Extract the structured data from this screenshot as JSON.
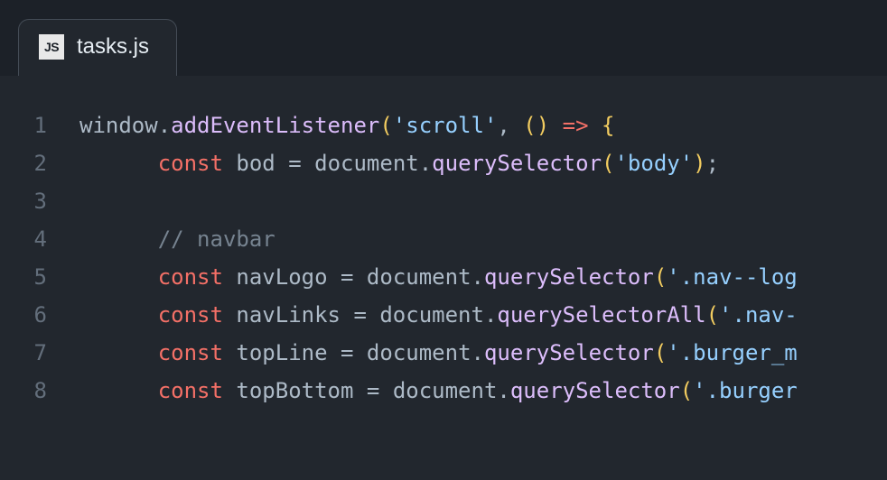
{
  "tab": {
    "icon_text": "JS",
    "filename": "tasks.js"
  },
  "gutter": {
    "1": "1",
    "2": "2",
    "3": "3",
    "4": "4",
    "5": "5",
    "6": "6",
    "7": "7",
    "8": "8"
  },
  "code": {
    "l1": {
      "obj": "window",
      "dot": ".",
      "method": "addEventListener",
      "open": "(",
      "arg1": "'scroll'",
      "comma": ", ",
      "arrow_open": "(",
      "arrow_close": ")",
      "arrow": " => ",
      "brace": "{"
    },
    "l2": {
      "indent": "      ",
      "kw": "const",
      "sp1": " ",
      "name": "bod",
      "eq": " = ",
      "obj": "document",
      "dot": ".",
      "method": "querySelector",
      "open": "(",
      "arg": "'body'",
      "close": ")",
      "semi": ";"
    },
    "l3": {
      "indent": ""
    },
    "l4": {
      "indent": "      ",
      "comment": "// navbar"
    },
    "l5": {
      "indent": "      ",
      "kw": "const",
      "sp1": " ",
      "name": "navLogo",
      "eq": " = ",
      "obj": "document",
      "dot": ".",
      "method": "querySelector",
      "open": "(",
      "arg": "'.nav--log"
    },
    "l6": {
      "indent": "      ",
      "kw": "const",
      "sp1": " ",
      "name": "navLinks",
      "eq": " = ",
      "obj": "document",
      "dot": ".",
      "method": "querySelectorAll",
      "open": "(",
      "arg": "'.nav-"
    },
    "l7": {
      "indent": "      ",
      "kw": "const",
      "sp1": " ",
      "name": "topLine",
      "eq": " = ",
      "obj": "document",
      "dot": ".",
      "method": "querySelector",
      "open": "(",
      "arg": "'.burger_m"
    },
    "l8": {
      "indent": "      ",
      "kw": "const",
      "sp1": " ",
      "name": "topBottom",
      "eq": " = ",
      "obj": "document",
      "dot": ".",
      "method": "querySelector",
      "open": "(",
      "arg": "'.burger"
    }
  }
}
